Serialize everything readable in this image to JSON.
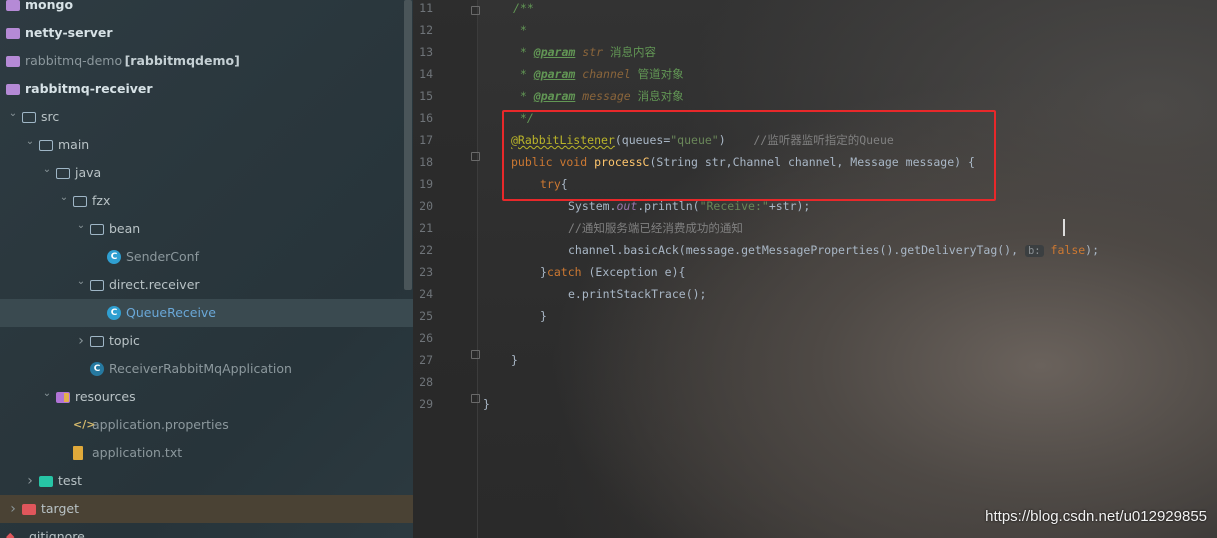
{
  "project_tree": {
    "items": [
      {
        "label": "mongo",
        "extra": "",
        "depth": 0,
        "icon": "module-folder-icon",
        "expanded": null
      },
      {
        "label": "netty-server",
        "extra": "",
        "depth": 0,
        "icon": "module-folder-icon",
        "expanded": null
      },
      {
        "label": "rabbitmq-demo",
        "extra": "[rabbitmqdemo]",
        "depth": 0,
        "icon": "module-folder-icon",
        "expanded": null
      },
      {
        "label": "rabbitmq-receiver",
        "extra": "",
        "depth": 0,
        "icon": "module-folder-icon",
        "expanded": null
      },
      {
        "label": "src",
        "extra": "",
        "depth": 0,
        "icon": "folder-icon",
        "expanded": true
      },
      {
        "label": "main",
        "extra": "",
        "depth": 1,
        "icon": "folder-icon",
        "expanded": true
      },
      {
        "label": "java",
        "extra": "",
        "depth": 2,
        "icon": "source-folder-icon",
        "expanded": true
      },
      {
        "label": "fzx",
        "extra": "",
        "depth": 3,
        "icon": "package-icon",
        "expanded": true
      },
      {
        "label": "bean",
        "extra": "",
        "depth": 4,
        "icon": "package-icon",
        "expanded": true
      },
      {
        "label": "SenderConf",
        "extra": "",
        "depth": 5,
        "icon": "class-icon",
        "expanded": null
      },
      {
        "label": "direct.receiver",
        "extra": "",
        "depth": 4,
        "icon": "package-icon",
        "expanded": true
      },
      {
        "label": "QueueReceive",
        "extra": "",
        "depth": 5,
        "icon": "class-icon",
        "expanded": null
      },
      {
        "label": "topic",
        "extra": "",
        "depth": 4,
        "icon": "package-icon",
        "expanded": false
      },
      {
        "label": "ReceiverRabbitMqApplication",
        "extra": "",
        "depth": 4,
        "icon": "spring-boot-class-icon",
        "expanded": null
      },
      {
        "label": "resources",
        "extra": "",
        "depth": 2,
        "icon": "resources-folder-icon",
        "expanded": true
      },
      {
        "label": "application.properties",
        "extra": "",
        "depth": 3,
        "icon": "properties-file-icon",
        "expanded": null
      },
      {
        "label": "application.txt",
        "extra": "",
        "depth": 3,
        "icon": "text-file-icon",
        "expanded": null
      },
      {
        "label": "test",
        "extra": "",
        "depth": 1,
        "icon": "test-folder-icon",
        "expanded": false
      },
      {
        "label": "target",
        "extra": "",
        "depth": 0,
        "icon": "excluded-folder-icon",
        "expanded": false
      },
      {
        "label": ".gitignore",
        "extra": "",
        "depth": 0,
        "icon": "git-file-icon",
        "expanded": null
      }
    ]
  },
  "editor": {
    "line_numbers": [
      "11",
      "12",
      "13",
      "14",
      "15",
      "16",
      "17",
      "18",
      "19",
      "20",
      "21",
      "22",
      "23",
      "24",
      "25",
      "26",
      "27",
      "28",
      "29"
    ],
    "lines": {
      "l11": "/**",
      "l12": " *",
      "l13_star": " * ",
      "l13_tag": "@param",
      "l13_param": "str",
      "l13_desc": "消息内容",
      "l14_star": " * ",
      "l14_tag": "@param",
      "l14_param": "channel",
      "l14_desc": "管道对象",
      "l15_star": " * ",
      "l15_tag": "@param",
      "l15_param": "message",
      "l15_desc": "消息对象",
      "l16": " */",
      "l17_ann": "@RabbitListener",
      "l17_open": "(queues=",
      "l17_str": "\"queue\"",
      "l17_close": ")",
      "l17_comment": "//监听器监听指定的Queue",
      "l18_kw": "public void ",
      "l18_fn": "processC",
      "l18_rest": "(String str,Channel channel, Message message) {",
      "l19_kw": "try",
      "l19_brace": "{",
      "l20_a": "System.",
      "l20_fld": "out",
      "l20_b": ".println(",
      "l20_str": "\"Receive:\"",
      "l20_c": "+str);",
      "l21_comment": "//通知服务端已经消费成功的通知",
      "l22_a": "channel.basicAck(message.getMessageProperties().getDeliveryTag(), ",
      "l22_hint": "b:",
      "l22_kw": " false",
      "l22_end": ");",
      "l23_a": "}",
      "l23_kw": "catch",
      "l23_b": " (Exception e){",
      "l24": "e.printStackTrace();",
      "l25": "}",
      "l27": "}",
      "l29": "}"
    }
  },
  "watermark": "https://blog.csdn.net/u012929855",
  "colors": {
    "highlight_box": "#e8282a",
    "keyword": "#cc7832",
    "annotation": "#bbb529",
    "doc_comment": "#629755",
    "string": "#6a8759",
    "method": "#ffc66d"
  }
}
